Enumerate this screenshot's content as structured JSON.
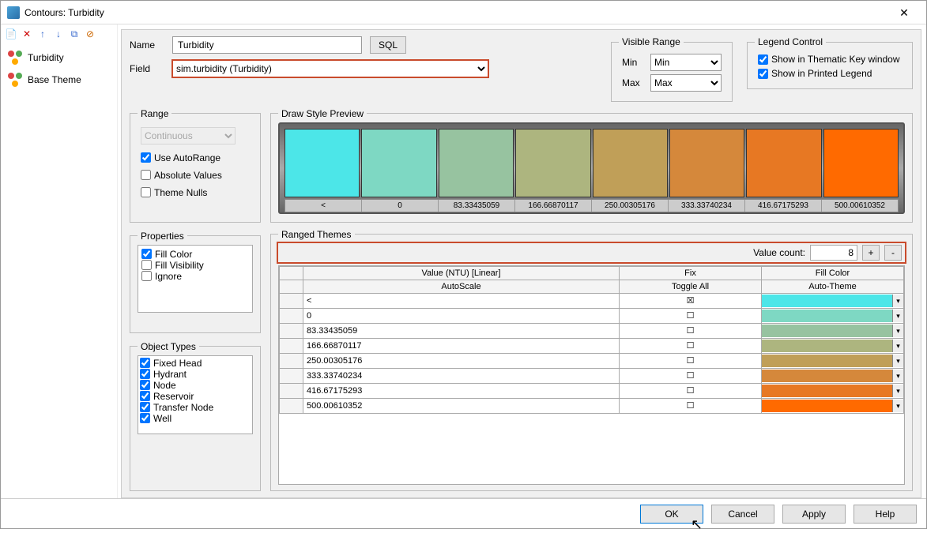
{
  "title": "Contours: Turbidity",
  "sidebar": {
    "items": [
      "Turbidity",
      "Base Theme"
    ]
  },
  "form": {
    "name_lbl": "Name",
    "name_val": "Turbidity",
    "sql_btn": "SQL",
    "field_lbl": "Field",
    "field_val": "sim.turbidity (Turbidity)"
  },
  "vrange": {
    "legend": "Visible Range",
    "min_lbl": "Min",
    "min_val": "Min",
    "max_lbl": "Max",
    "max_val": "Max"
  },
  "lctrl": {
    "legend": "Legend Control",
    "opt1": "Show in Thematic Key window",
    "opt2": "Show in Printed Legend"
  },
  "range": {
    "legend": "Range",
    "mode": "Continuous",
    "auto": "Use AutoRange",
    "abs": "Absolute Values",
    "nulls": "Theme Nulls"
  },
  "props": {
    "legend": "Properties",
    "fc": "Fill Color",
    "fv": "Fill Visibility",
    "ig": "Ignore"
  },
  "obj": {
    "legend": "Object Types",
    "items": [
      "Fixed Head",
      "Hydrant",
      "Node",
      "Reservoir",
      "Transfer Node",
      "Well"
    ]
  },
  "preview": {
    "legend": "Draw Style Preview",
    "colors": [
      "#4ce6e8",
      "#7ed8c3",
      "#97c3a0",
      "#adb57f",
      "#c09f58",
      "#d5883b",
      "#e77823",
      "#ff6a00"
    ],
    "labels": [
      "<",
      "0",
      "83.33435059",
      "166.66870117",
      "250.00305176",
      "333.33740234",
      "416.67175293",
      "500.00610352"
    ]
  },
  "ranged": {
    "legend": "Ranged Themes",
    "vc_lbl": "Value count:",
    "vc_val": "8",
    "col1": "Value (NTU) [Linear]",
    "col2": "Fix",
    "col3": "Fill Color",
    "sub1": "AutoScale",
    "sub2": "Toggle All",
    "sub3": "Auto-Theme",
    "rows": [
      {
        "v": "<",
        "fix": "x",
        "c": "#4ce6e8"
      },
      {
        "v": "0",
        "fix": "",
        "c": "#7ed8c3"
      },
      {
        "v": "83.33435059",
        "fix": "",
        "c": "#97c3a0"
      },
      {
        "v": "166.66870117",
        "fix": "",
        "c": "#adb57f"
      },
      {
        "v": "250.00305176",
        "fix": "",
        "c": "#c09f58"
      },
      {
        "v": "333.33740234",
        "fix": "",
        "c": "#d5883b"
      },
      {
        "v": "416.67175293",
        "fix": "",
        "c": "#e77823"
      },
      {
        "v": "500.00610352",
        "fix": "",
        "c": "#ff6a00"
      }
    ]
  },
  "buttons": {
    "ok": "OK",
    "cancel": "Cancel",
    "apply": "Apply",
    "help": "Help"
  }
}
